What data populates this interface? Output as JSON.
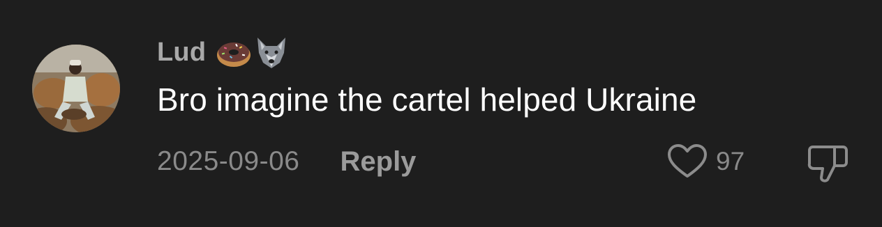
{
  "comment": {
    "username": "Lud",
    "badges": [
      "donut-icon",
      "wolf-icon"
    ],
    "text": "Bro imagine the cartel helped Ukraine",
    "timestamp": "2025-09-06",
    "reply_label": "Reply",
    "like_count": "97",
    "icons": {
      "like": "heart-outline-icon",
      "dislike": "thumbs-down-outline-icon"
    }
  },
  "colors": {
    "background": "#1e1e1e",
    "text_primary": "#ffffff",
    "text_secondary": "#8a8a8a",
    "username": "#a9a9a9"
  }
}
